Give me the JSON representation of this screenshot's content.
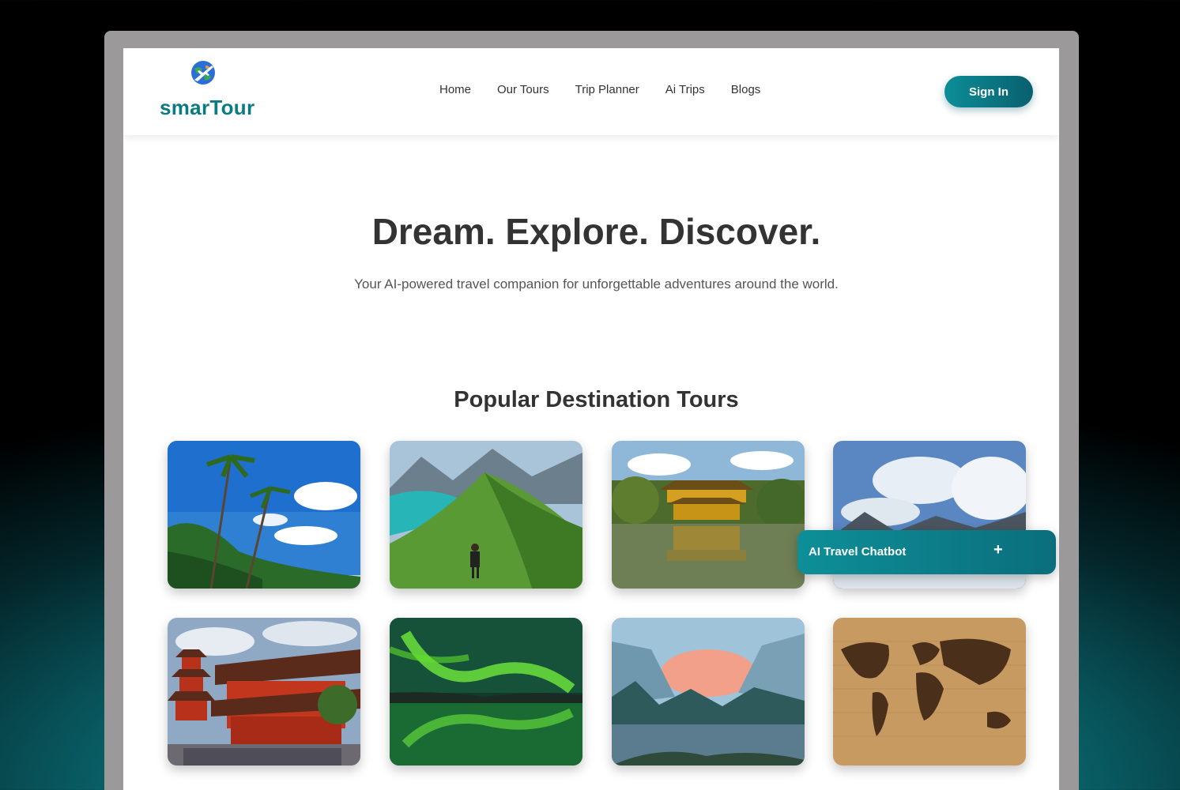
{
  "brand": {
    "name": "smarTour",
    "logo_icon": "globe-plane-icon"
  },
  "nav": {
    "items": [
      {
        "label": "Home"
      },
      {
        "label": "Our Tours"
      },
      {
        "label": "Trip Planner"
      },
      {
        "label": "Ai Trips"
      },
      {
        "label": "Blogs"
      }
    ],
    "sign_in_label": "Sign In"
  },
  "hero": {
    "title": "Dream. Explore. Discover.",
    "subtitle": "Your AI-powered travel companion for unforgettable adventures around the world."
  },
  "tours": {
    "section_title": "Popular Destination Tours",
    "cards": [
      {
        "image": "tropical-beach-palms"
      },
      {
        "image": "mountain-ridge-lake-hiker"
      },
      {
        "image": "golden-pavilion-temple"
      },
      {
        "image": "snowy-mountains-clouds"
      },
      {
        "image": "red-japanese-temple-pagoda"
      },
      {
        "image": "northern-lights-reflection"
      },
      {
        "image": "valley-river-sunset"
      },
      {
        "image": "wooden-world-map"
      }
    ]
  },
  "chatbot": {
    "label": "AI Travel Chatbot",
    "toggle_symbol": "+"
  },
  "colors": {
    "brand": "#0b7b82",
    "button": "#0c8e97",
    "text": "#333333"
  }
}
